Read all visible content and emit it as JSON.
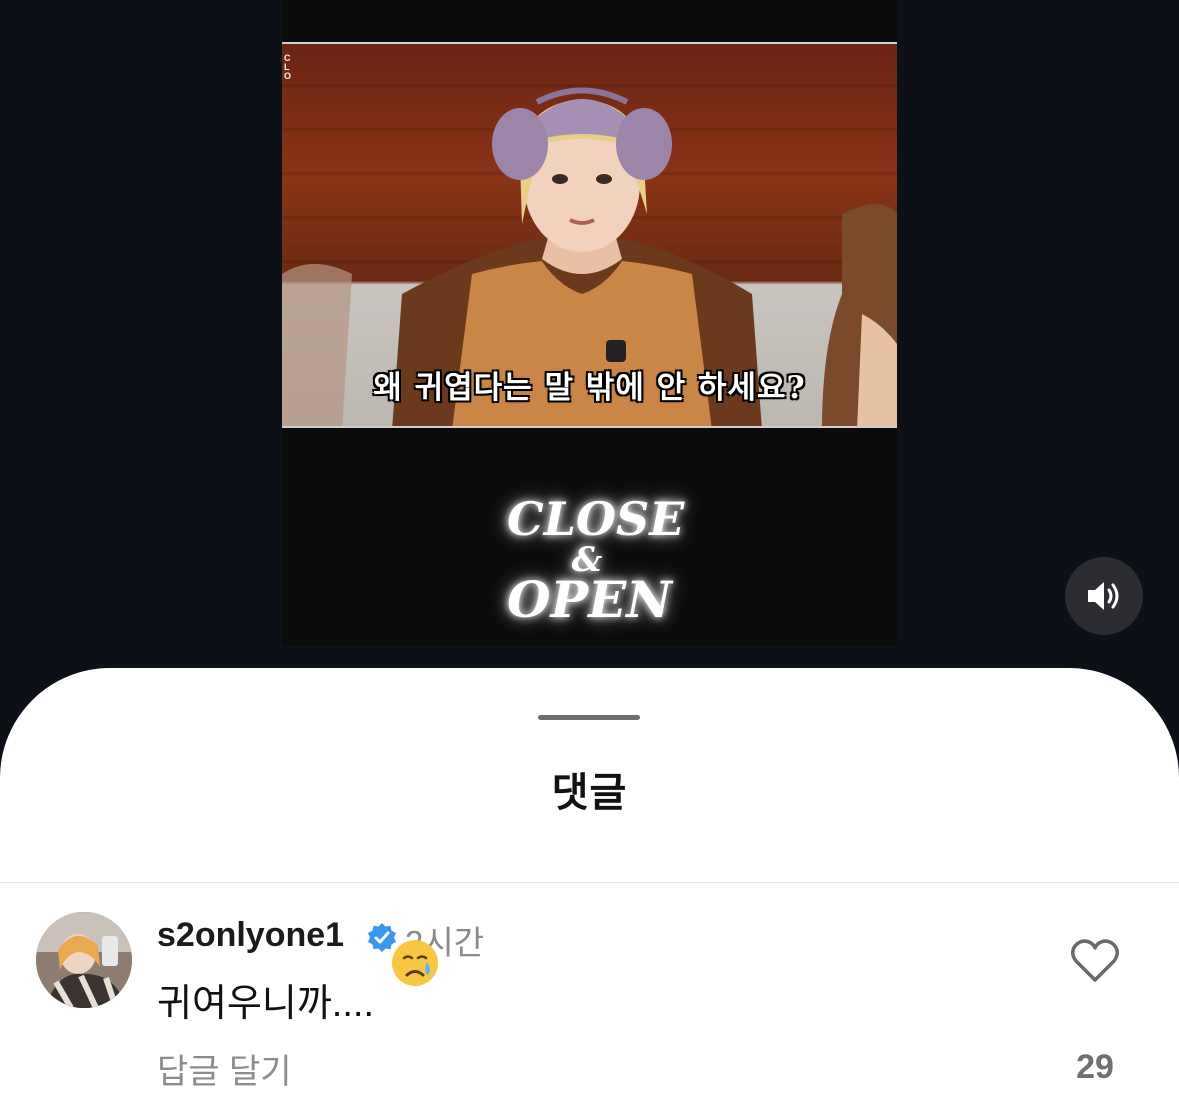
{
  "video": {
    "subtitle": "왜 귀엽다는 말 밖에 안 하세요?",
    "channel_logo_small": "CLOSE OPEN",
    "brand_logo": {
      "line1": "CLOSE",
      "line2": "&",
      "line3": "OPEN"
    },
    "mute_icon": "speaker-volume-icon"
  },
  "sheet": {
    "title": "댓글"
  },
  "comment": {
    "username": "s2onlyone1",
    "verified_icon": "verified-badge-icon",
    "time": "2시간",
    "text": "귀여우니까....",
    "emoji": "crying-face-emoji",
    "reply_label": "답글 달기",
    "like_icon": "heart-outline-icon",
    "like_count": "29"
  },
  "colors": {
    "background": "#0d1016",
    "sheet": "#ffffff",
    "verified": "#3897f0",
    "muted_text": "#8a8a8a"
  }
}
